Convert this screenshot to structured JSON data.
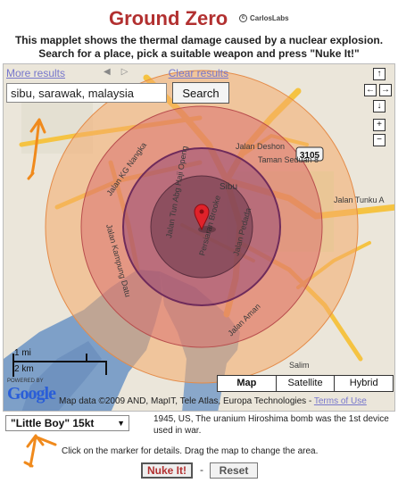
{
  "header": {
    "title": "Ground Zero",
    "brand": "CarlosLabs",
    "description_line1": "This mapplet shows the thermal damage caused by a nuclear explosion.",
    "description_line2": "Search for a place, pick a suitable weapon and press \"Nuke It!\""
  },
  "search": {
    "more_results": "More results",
    "clear_results": "Clear results",
    "value": "sibu, sarawak, malaysia",
    "button_label": "Search"
  },
  "map": {
    "streets": {
      "jalan_kg_nangka": "Jalan KG Nangka",
      "jalan_deshon": "Jalan Deshon",
      "taman_seduan": "Taman Seduan 8",
      "sibu": "Sibu",
      "route_3105": "3105",
      "jalan_tunku": "Jalan Tunku A",
      "jalan_kampung_datu": "Jalan Kampung Datu",
      "jalan_tun_abg_haji_openg": "Jalan Tun Abg Haji Openg",
      "persiaran_brooke": "Persiaran Brooke",
      "jalan_pedada": "Jalan Pedada",
      "jalan_aman": "Jalan Aman",
      "salim": "Salim"
    },
    "scale": {
      "miles": "1 mi",
      "km": "2 km"
    },
    "powered_by": "POWERED BY",
    "google": "Google",
    "attribution": "Map data ©2009 AND, MapIT, Tele Atlas, Europa Technologies - ",
    "terms": "Terms of Use",
    "map_types": [
      "Map",
      "Satellite",
      "Hybrid"
    ],
    "active_map_type": "Map",
    "colors": {
      "water": "#7ea0c8",
      "road": "#f5c342",
      "ring_outer": "#f4a96a",
      "ring_mid": "#d86a6a",
      "ring_inner": "#8a3b73",
      "ring_core": "#6e3b4d",
      "marker": "#e0222a"
    }
  },
  "weapon": {
    "selected": "\"Little Boy\" 15kt",
    "description": "1945, US, The uranium Hiroshima bomb was the 1st device used in war."
  },
  "hint": "Click on the marker for details. Drag the map to change the area.",
  "actions": {
    "nuke": "Nuke It!",
    "separator": "-",
    "reset": "Reset"
  }
}
